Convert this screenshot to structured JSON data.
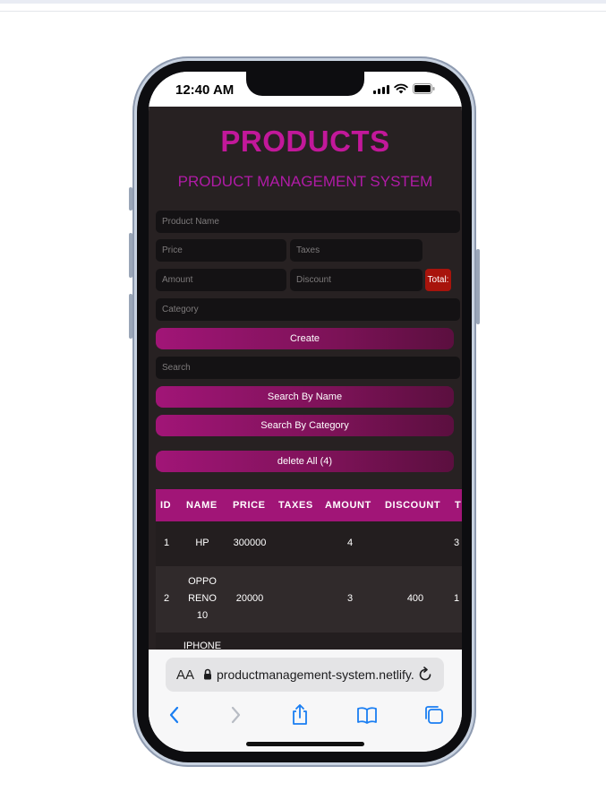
{
  "status_bar": {
    "time": "12:40 AM"
  },
  "app": {
    "title": "PRODUCTS",
    "subtitle": "PRODUCT MANAGEMENT SYSTEM",
    "form": {
      "product_name_placeholder": "Product Name",
      "price_placeholder": "Price",
      "taxes_placeholder": "Taxes",
      "amount_placeholder": "Amount",
      "discount_placeholder": "Discount",
      "total_label": "Total:",
      "category_placeholder": "Category",
      "create_label": "Create"
    },
    "search": {
      "placeholder": "Search",
      "by_name_label": "Search By Name",
      "by_category_label": "Search By Category"
    },
    "delete_all_label": "delete All (4)",
    "table": {
      "headers": [
        "ID",
        "NAME",
        "PRICE",
        "TAXES",
        "AMOUNT",
        "DISCOUNT",
        "T"
      ],
      "rows": [
        {
          "id": "1",
          "name": "HP",
          "price": "300000",
          "taxes": "",
          "amount": "4",
          "discount": "",
          "total": "3"
        },
        {
          "id": "2",
          "name": "OPPO RENO 10",
          "price": "20000",
          "taxes": "",
          "amount": "3",
          "discount": "400",
          "total": "1"
        },
        {
          "id": "",
          "name": "IPHONE",
          "price": "",
          "taxes": "",
          "amount": "",
          "discount": "",
          "total": ""
        }
      ]
    },
    "colors": {
      "accent": "#c2189a",
      "background": "#272122",
      "total_badge": "#a8140c"
    }
  },
  "browser": {
    "aa_label": "AA",
    "url": "productmanagement-system.netlify.app",
    "icons": [
      "back-icon",
      "forward-icon",
      "share-icon",
      "bookmarks-icon",
      "tabs-icon",
      "reload-icon",
      "lock-icon"
    ]
  }
}
